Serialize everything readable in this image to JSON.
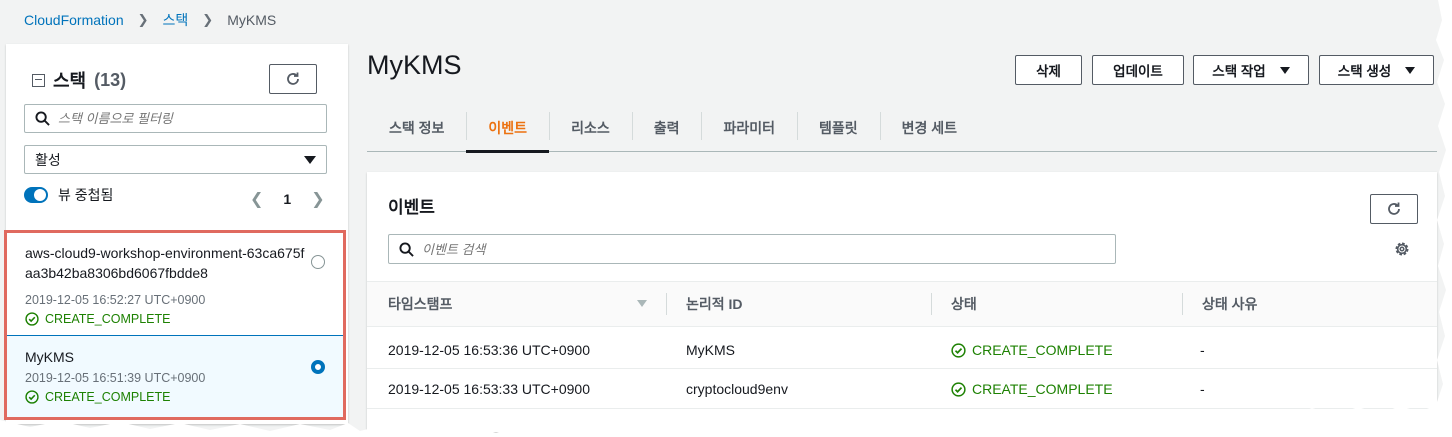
{
  "breadcrumb": {
    "root": "CloudFormation",
    "middle": "스택",
    "current": "MyKMS"
  },
  "left": {
    "title": "스택",
    "count": "(13)",
    "filter_placeholder": "스택 이름으로 필터링",
    "status_filter": "활성",
    "toggle_label": "뷰 중첩됨",
    "page": "1",
    "stacks": [
      {
        "name": "aws-cloud9-workshop-environment-63ca675faa3b42ba8306bd6067fbdde8",
        "time": "2019-12-05 16:52:27 UTC+0900",
        "status": "CREATE_COMPLETE",
        "selected": false
      },
      {
        "name": "MyKMS",
        "time": "2019-12-05 16:51:39 UTC+0900",
        "status": "CREATE_COMPLETE",
        "selected": true
      }
    ]
  },
  "main": {
    "title": "MyKMS",
    "buttons": {
      "delete": "삭제",
      "update": "업데이트",
      "stack_actions": "스택 작업",
      "create": "스택 생성"
    },
    "tabs": [
      "스택 정보",
      "이벤트",
      "리소스",
      "출력",
      "파라미터",
      "템플릿",
      "변경 세트"
    ],
    "active_tab": "이벤트"
  },
  "events": {
    "title": "이벤트",
    "search_placeholder": "이벤트 검색",
    "columns": [
      "타임스탬프",
      "논리적 ID",
      "상태",
      "상태 사유"
    ],
    "rows": [
      {
        "timestamp": "2019-12-05 16:53:36 UTC+0900",
        "logical_id": "MyKMS",
        "status": "CREATE_COMPLETE",
        "reason": "-"
      },
      {
        "timestamp": "2019-12-05 16:53:33 UTC+0900",
        "logical_id": "cryptocloud9env",
        "status": "CREATE_COMPLETE",
        "reason": "-"
      }
    ]
  },
  "colors": {
    "link": "#0073bb",
    "success": "#1d8102",
    "active_tab": "#ec7211",
    "highlight_border": "#e06a5f"
  }
}
